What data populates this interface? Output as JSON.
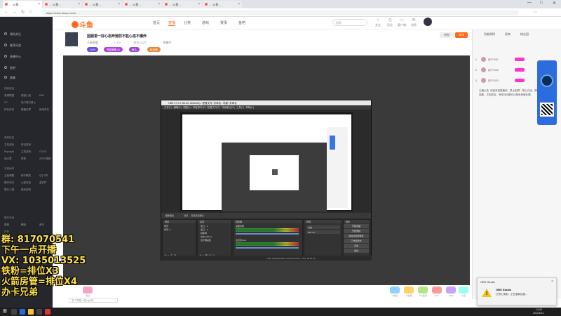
{
  "browser": {
    "tabs": [
      {
        "label": "…·斗鱼…"
      },
      {
        "label": "…·斗鱼…"
      },
      {
        "label": "…·斗鱼…"
      },
      {
        "label": "…·斗鱼…"
      },
      {
        "label": "…·斗鱼…"
      },
      {
        "label": "…·斗鱼…"
      }
    ],
    "address": "https://www.douyu.com/...",
    "minimize": "—",
    "maximize": "□",
    "close": "✕"
  },
  "site": {
    "logo_text": "斗鱼",
    "nav": [
      "首页",
      "直播",
      "分类",
      "游戏",
      "赛事",
      "鱼吧"
    ],
    "nav_active": 1,
    "search_placeholder": "搜索",
    "header_icons": [
      {
        "glyph": "☆",
        "label": "关注"
      },
      {
        "glyph": "◷",
        "label": "历史"
      },
      {
        "glyph": "▭",
        "label": "客户端"
      },
      {
        "glyph": "✉",
        "label": "消息"
      }
    ]
  },
  "sidebar": {
    "items": [
      {
        "label": "我的关注"
      },
      {
        "label": "推荐分类"
      },
      {
        "label": "直播中心"
      },
      {
        "label": "鱼吧"
      },
      {
        "label": "赛事"
      }
    ],
    "sections": [
      {
        "title": "网游竞技",
        "tags": [
          "英雄联盟",
          "穿越火线",
          "DNF",
          "CF",
          "地下城与勇士",
          "炉石传说",
          "魔兽世界",
          "绝地求生"
        ]
      },
      {
        "title": "单机热游",
        "tags": [
          "主机游戏",
          "怀旧游戏",
          "Popnight",
          "主机游戏",
          "CSGO",
          "逆水寒",
          "原神",
          "APEX英雄"
        ]
      },
      {
        "title": "手游休闲",
        "tags": [
          "王者荣耀",
          "和平精英",
          "QQ飞车",
          "蛋仔派对",
          "火影忍者",
          "金铲铲",
          "第五人格",
          "使命召唤"
        ]
      },
      {
        "title": "娱乐天地",
        "tags": [
          "颜值",
          "舞蹈",
          "音乐",
          "户外"
        ]
      }
    ]
  },
  "room": {
    "title": "国服第一好心态奔驰防不胜心态不爆炸",
    "streamer_tag": "王者荣耀",
    "meta": [
      "· 1.3万",
      "· 关注 2.1万",
      "· 直播中"
    ],
    "pills": [
      {
        "label": "LV24",
        "color": "#6b4fd8"
      },
      {
        "label": "专属荣耀 x3",
        "color": "#b043e0"
      },
      {
        "label": "鱼丸",
        "color": "#9a47d6"
      },
      {
        "label": "粉丝团",
        "color": "#e6883a"
      }
    ],
    "btn_follow": "关注",
    "btn_report": "举报"
  },
  "obs": {
    "title": "OBS 27.2.4 (64-bit, windows) - 配置文件: 未命名 - 场景: 未命名",
    "menu": [
      "文件(F)",
      "编辑(E)",
      "视图(V)",
      "停靠部件(D)",
      "配置文件(P)",
      "场景集合(S)",
      "工具(T)",
      "帮助(H)"
    ],
    "docks": [
      {
        "title": "场景",
        "items": [
          "场景",
          "场景 2"
        ]
      },
      {
        "title": "来源",
        "items": [
          "窗口 · 1",
          "窗口 · 2",
          "媒体源",
          "文本 (GDI+)",
          "显示器采集"
        ]
      },
      {
        "title": "混音器",
        "items": [
          "桌面音频",
          "麦克风/Aux"
        ]
      },
      {
        "title": "转场",
        "items": [
          "淡出",
          "300 ms"
        ]
      },
      {
        "title": "控件",
        "items": [
          "开始直播",
          "开始录制",
          "启动虚拟摄像机",
          "工作室模式",
          "设置",
          "退出"
        ]
      }
    ],
    "tabs": [
      "图像属性",
      "滤镜",
      "音频高级属性"
    ],
    "status": "LIVE: 00:00:00   REC: 00:00:00   CPU: 3.2%, 30.00 fps"
  },
  "overlay": {
    "lines": [
      "群: 817070541",
      "下午一点开播",
      "VX: 1035013525",
      "铁粉=排位X3",
      "火箭房管=排位X4",
      "办卡兄弟"
    ]
  },
  "gifts": [
    {
      "color": "#f7a3c7",
      "n": "1鱼丸"
    },
    {
      "color": "#8fd0ff",
      "n": "6鱼翅"
    },
    {
      "color": "#ffd166",
      "n": "10鱼翅"
    },
    {
      "color": "#b3e683",
      "n": "100鱼翅"
    },
    {
      "color": "#f99",
      "n": "520"
    },
    {
      "color": "#c8a2ff",
      "n": "1314"
    },
    {
      "color": "#9fe",
      "n": "火箭"
    }
  ],
  "chat_placeholder": "发个弹幕一起high吧",
  "right": {
    "tabs": [
      "贡献周榜",
      "贵宾",
      "粉丝团"
    ],
    "rank": [
      {
        "n": "1",
        "name": "用户1001"
      },
      {
        "n": "2",
        "name": "用户1002"
      },
      {
        "n": "3",
        "name": "用户1003"
      }
    ],
    "notice": "主播公告: 欢迎来到直播间，禁止刷屏、禁止引战，理性观看，文明发言，有任何问题可以联系房管处理。"
  },
  "toast": {
    "app": "OBS Studio",
    "title": "OBS Studio",
    "body": "已停止录制，正在重新连接..."
  },
  "clock": {
    "time": "14:45",
    "date": "2022/5/12"
  }
}
